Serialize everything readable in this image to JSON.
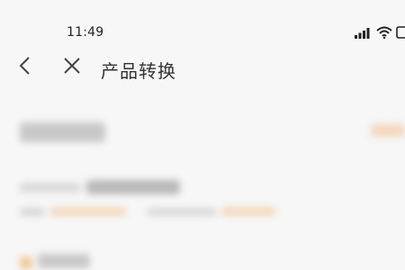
{
  "status_bar": {
    "time": "11:49",
    "icons": [
      "signal-icon",
      "wifi-icon",
      "battery-icon"
    ]
  },
  "nav": {
    "title": "产品转换",
    "back_icon": "chevron-left-icon",
    "close_icon": "close-icon"
  },
  "colors": {
    "background": "#f7f7f7",
    "text_primary": "#333333",
    "accent_orange": "#f3d8bd"
  }
}
